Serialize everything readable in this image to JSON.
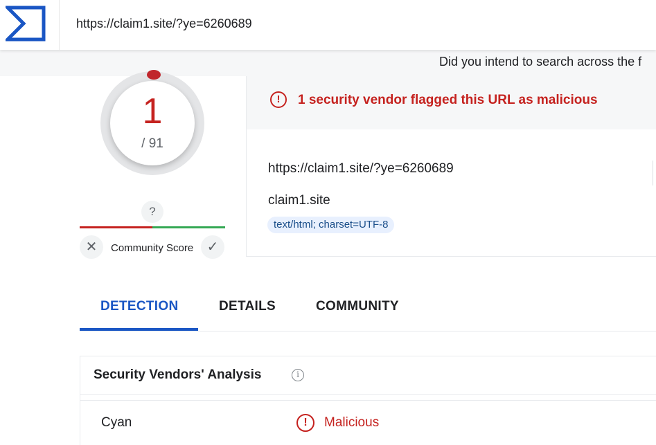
{
  "search": {
    "value": "https://claim1.site/?ye=6260689"
  },
  "hint_text": "Did you intend to search across the f",
  "score": {
    "detections": "1",
    "total": "/ 91",
    "question_mark": "?",
    "community_label": "Community Score",
    "vote_down_glyph": "✕",
    "vote_up_glyph": "✓"
  },
  "alert": {
    "icon_glyph": "!",
    "text": "1 security vendor flagged this URL as malicious"
  },
  "details": {
    "url": "https://claim1.site/?ye=6260689",
    "domain": "claim1.site",
    "content_type": "text/html; charset=UTF-8"
  },
  "tabs": [
    {
      "label": "DETECTION",
      "active": true
    },
    {
      "label": "DETAILS",
      "active": false
    },
    {
      "label": "COMMUNITY",
      "active": false
    }
  ],
  "section": {
    "title": "Security Vendors' Analysis",
    "info_glyph": "i"
  },
  "vendors": [
    {
      "name": "Cyan",
      "result": "Malicious",
      "icon_glyph": "!"
    }
  ],
  "colors": {
    "malicious": "#c5221f",
    "accent_blue": "#1a56c4",
    "harmless": "#34a853"
  }
}
